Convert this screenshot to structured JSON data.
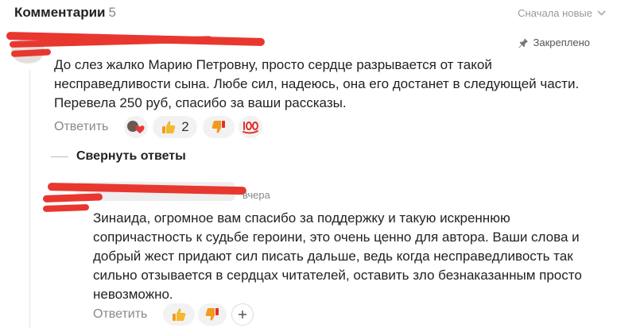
{
  "header": {
    "title": "Комментарии",
    "count": "5",
    "sort_label": "Сначала новые"
  },
  "comment1": {
    "pinned_label": "Закреплено",
    "text": "До слез жалко Марию Петровну, просто сердце разрывается от такой несправедливости сына. Любе сил, надеюсь, она его достанет в следующей части. Перевела 250 руб, спасибо за ваши рассказы.",
    "reply_label": "Ответить",
    "likes": "2",
    "collapse_label": "Свернуть ответы"
  },
  "comment2": {
    "time": "вчера",
    "text": "Зинаида, огромное вам спасибо за поддержку и такую искреннюю сопричастность к судьбе героини, это очень ценно для автора. Ваши слова и добрый жест придают сил писать дальше, ведь когда несправедливость так сильно отзывается в сердцах читателей, оставить зло безнаказанным просто невозможно.",
    "reply_label": "Ответить"
  },
  "colors": {
    "redaction": "#e8372f",
    "like_yellow": "#f5b82e",
    "dislike_orange": "#f39a1e",
    "hundred_red": "#e0312c"
  },
  "icons": [
    "chevron-down-icon",
    "pin-icon",
    "heart-reaction-icon",
    "thumbs-up-icon",
    "thumbs-down-icon",
    "hundred-icon",
    "plus-icon"
  ]
}
